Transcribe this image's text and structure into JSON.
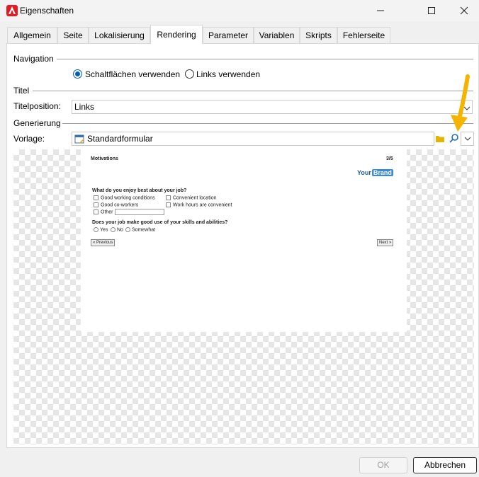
{
  "window": {
    "title": "Eigenschaften"
  },
  "tabs": [
    {
      "label": "Allgemein"
    },
    {
      "label": "Seite"
    },
    {
      "label": "Lokalisierung"
    },
    {
      "label": "Rendering"
    },
    {
      "label": "Parameter"
    },
    {
      "label": "Variablen"
    },
    {
      "label": "Skripts"
    },
    {
      "label": "Fehlerseite"
    }
  ],
  "active_tab": "Rendering",
  "navigation": {
    "label": "Navigation",
    "option_buttons": "Schaltflächen verwenden",
    "option_links": "Links verwenden",
    "selected": "Schaltflächen verwenden"
  },
  "titel": {
    "label": "Titel",
    "position_label": "Titelposition:",
    "position_value": "Links"
  },
  "generierung": {
    "label": "Generierung",
    "template_label": "Vorlage:",
    "template_value": "Standardformular"
  },
  "preview": {
    "heading": "Motivations",
    "page": "3/5",
    "brand_your": "Your",
    "brand_brand": "Brand",
    "q1": "What do you enjoy best about your job?",
    "q1_options": [
      "Good working conditions",
      "Convenient location",
      "Good co-workers",
      "Work hours are convenient",
      "Other"
    ],
    "q2": "Does your job make good use of your skills and abilities?",
    "q2_options": [
      "Yes",
      "No",
      "Somewhat"
    ],
    "prev": "« Previous",
    "next": "Next »"
  },
  "buttons": {
    "ok": "OK",
    "cancel": "Abbrechen"
  },
  "colors": {
    "accent": "#005fb8",
    "arrow": "#f5b400",
    "folder": "#e8b400"
  }
}
